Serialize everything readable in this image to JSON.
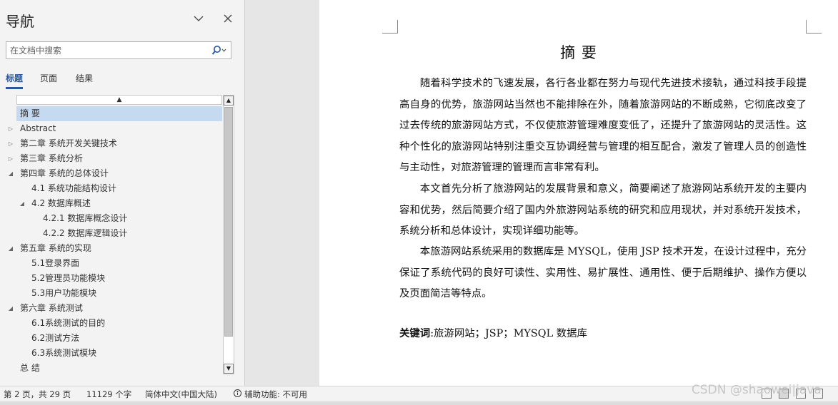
{
  "nav": {
    "title": "导航",
    "search_placeholder": "在文档中搜索",
    "tabs": [
      {
        "label": "标题",
        "active": true
      },
      {
        "label": "页面",
        "active": false
      },
      {
        "label": "结果",
        "active": false
      }
    ],
    "tree": [
      {
        "label": "摘 要",
        "level": 1,
        "arrow": "none",
        "selected": true
      },
      {
        "label": "Abstract",
        "level": 1,
        "arrow": "collapsed"
      },
      {
        "label": "第二章 系统开发关键技术",
        "level": 1,
        "arrow": "collapsed"
      },
      {
        "label": "第三章 系统分析",
        "level": 1,
        "arrow": "collapsed"
      },
      {
        "label": "第四章 系统的总体设计",
        "level": 1,
        "arrow": "expanded"
      },
      {
        "label": "4.1 系统功能结构设计",
        "level": 2,
        "arrow": "none"
      },
      {
        "label": "4.2 数据库概述",
        "level": 2,
        "arrow": "expanded"
      },
      {
        "label": "4.2.1 数据库概念设计",
        "level": 3,
        "arrow": "none"
      },
      {
        "label": "4.2.2 数据库逻辑设计",
        "level": 3,
        "arrow": "none"
      },
      {
        "label": "第五章 系统的实现",
        "level": 1,
        "arrow": "expanded"
      },
      {
        "label": "5.1登录界面",
        "level": 2,
        "arrow": "none"
      },
      {
        "label": "5.2管理员功能模块",
        "level": 2,
        "arrow": "none"
      },
      {
        "label": "5.3用户功能模块",
        "level": 2,
        "arrow": "none"
      },
      {
        "label": "第六章 系统测试",
        "level": 1,
        "arrow": "expanded"
      },
      {
        "label": "6.1系统测试的目的",
        "level": 2,
        "arrow": "none"
      },
      {
        "label": "6.2测试方法",
        "level": 2,
        "arrow": "none"
      },
      {
        "label": "6.3系统测试模块",
        "level": 2,
        "arrow": "none"
      },
      {
        "label": "总 结",
        "level": 1,
        "arrow": "none"
      }
    ]
  },
  "document": {
    "title": "摘 要",
    "paragraphs": [
      "随着科学技术的飞速发展，各行各业都在努力与现代先进技术接轨，通过科技手段提高自身的优势，旅游网站当然也不能排除在外，随着旅游网站的不断成熟，它彻底改变了过去传统的旅游网站方式，不仅使旅游管理难度变低了，还提升了旅游网站的灵活性。这种个性化的旅游网站特别注重交互协调经营与管理的相互配合，激发了管理人员的创造性与主动性，对旅游管理的管理而言非常有利。",
      "本文首先分析了旅游网站的发展背景和意义，简要阐述了旅游网站系统开发的主要内容和优势，然后简要介绍了国内外旅游网站系统的研究和应用现状，并对系统开发技术，系统分析和总体设计，实现详细功能等。",
      "本旅游网站系统采用的数据库是 MYSQL，使用 JSP 技术开发，在设计过程中，充分保证了系统代码的良好可读性、实用性、易扩展性、通用性、便于后期维护、操作方便以及页面简洁等特点。"
    ],
    "keywords_label": "关键词",
    "keywords_value": ":旅游网站；JSP；MYSQL 数据库"
  },
  "statusbar": {
    "page": "第 2 页，共 29 页",
    "words": "11129 个字",
    "language": "简体中文(中国大陆)",
    "accessibility": "辅助功能: 不可用"
  },
  "watermark": "CSDN @shaowei|java",
  "colors": {
    "accent": "#2b579a",
    "selection": "#c5d9f1",
    "pane_bg": "#f3f3f3",
    "canvas_bg": "#e6e6e6"
  }
}
